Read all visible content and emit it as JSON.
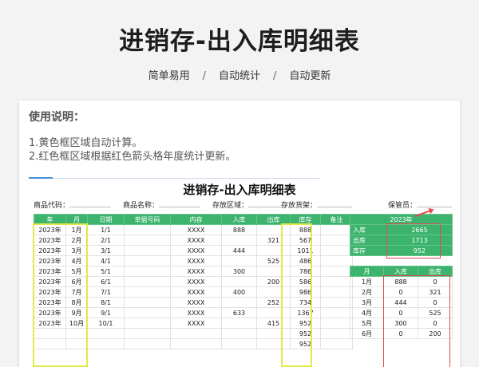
{
  "page": {
    "title": "进销存-出入库明细表",
    "features": [
      "简单易用",
      "自动统计",
      "自动更新"
    ],
    "separator": "/"
  },
  "instructions": {
    "heading": "使用说明：",
    "line1": "1.黄色框区域自动计算。",
    "line2": "2.红色框区域根据红色箭头格年度统计更新。"
  },
  "sheet": {
    "title": "进销存-出入库明细表",
    "meta": {
      "product_code": "商品代码：",
      "product_name": "商品名称：",
      "storage_area": "存放区域：",
      "storage_shelf": "存放货架：",
      "keeper": "保管员："
    },
    "headers": [
      "年",
      "月",
      "日期",
      "单据号码",
      "内容",
      "入库",
      "出库",
      "库存",
      "备注"
    ],
    "rows": [
      [
        "2023年",
        "1月",
        "1/1",
        "",
        "XXXX",
        "888",
        "",
        "888",
        ""
      ],
      [
        "2023年",
        "2月",
        "2/1",
        "",
        "XXXX",
        "",
        "321",
        "567",
        ""
      ],
      [
        "2023年",
        "3月",
        "3/1",
        "",
        "XXXX",
        "444",
        "",
        "1011",
        ""
      ],
      [
        "2023年",
        "4月",
        "4/1",
        "",
        "XXXX",
        "",
        "525",
        "486",
        ""
      ],
      [
        "2023年",
        "5月",
        "5/1",
        "",
        "XXXX",
        "300",
        "",
        "786",
        ""
      ],
      [
        "2023年",
        "6月",
        "6/1",
        "",
        "XXXX",
        "",
        "200",
        "586",
        ""
      ],
      [
        "2023年",
        "7月",
        "7/1",
        "",
        "XXXX",
        "400",
        "",
        "986",
        ""
      ],
      [
        "2023年",
        "8月",
        "8/1",
        "",
        "XXXX",
        "",
        "252",
        "734",
        ""
      ],
      [
        "2023年",
        "9月",
        "9/1",
        "",
        "XXXX",
        "633",
        "",
        "1367",
        ""
      ],
      [
        "2023年",
        "10月",
        "10/1",
        "",
        "XXXX",
        "",
        "415",
        "952",
        ""
      ],
      [
        "",
        "",
        "",
        "",
        "",
        "",
        "",
        "952",
        ""
      ],
      [
        "",
        "",
        "",
        "",
        "",
        "",
        "",
        "952",
        ""
      ]
    ]
  },
  "summary": {
    "year": "2023年",
    "in_label": "入库",
    "in_value": "2665",
    "out_label": "出库",
    "out_value": "1713",
    "stock_label": "库存",
    "stock_value": "952"
  },
  "monthly": {
    "headers": [
      "月",
      "入库",
      "出库"
    ],
    "rows": [
      [
        "1月",
        "888",
        "0"
      ],
      [
        "2月",
        "0",
        "321"
      ],
      [
        "3月",
        "444",
        "0"
      ],
      [
        "4月",
        "0",
        "525"
      ],
      [
        "5月",
        "300",
        "0"
      ],
      [
        "6月",
        "0",
        "200"
      ]
    ]
  },
  "colors": {
    "header_green": "#3cb46e",
    "highlight_yellow": "#e3e84a",
    "highlight_red": "#e04b4b"
  }
}
